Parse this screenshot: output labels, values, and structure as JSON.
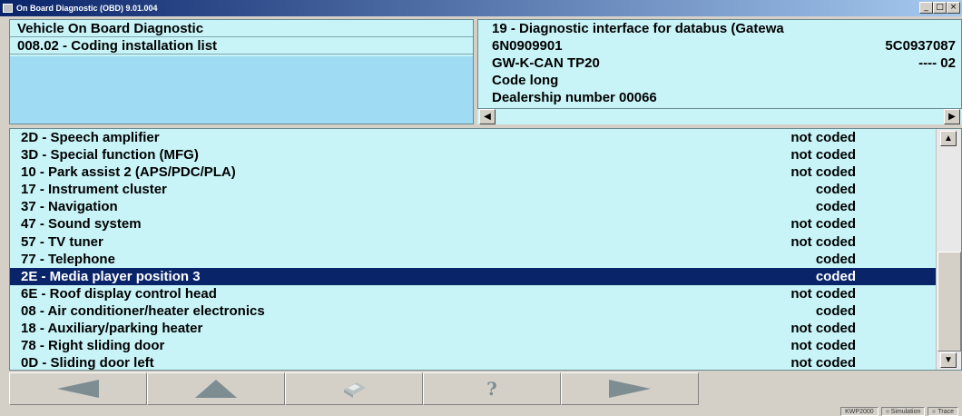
{
  "window": {
    "title": "On Board Diagnostic (OBD) 9.01.004",
    "minimize": "_",
    "maximize": "□",
    "close": "×"
  },
  "left_panel": {
    "line1": "Vehicle On Board Diagnostic",
    "line2": "008.02 - Coding installation list"
  },
  "right_panel": {
    "title": "19 - Diagnostic interface for databus (Gatewa",
    "part_left": "6N0909901",
    "part_right": "5C0937087",
    "component_left": "GW-K-CAN TP20",
    "component_right": "---- 02",
    "coding": "Code long",
    "dealership": "Dealership number 00066"
  },
  "list": {
    "rows": [
      {
        "name": "2D - Speech amplifier",
        "status": "not coded"
      },
      {
        "name": "3D - Special function (MFG)",
        "status": "not coded"
      },
      {
        "name": "10 - Park assist 2 (APS/PDC/PLA)",
        "status": "not coded"
      },
      {
        "name": "17 - Instrument cluster",
        "status": "coded"
      },
      {
        "name": "37 - Navigation",
        "status": "coded"
      },
      {
        "name": "47 - Sound system",
        "status": "not coded"
      },
      {
        "name": "57 - TV tuner",
        "status": "not coded"
      },
      {
        "name": "77 - Telephone",
        "status": "coded"
      },
      {
        "name": "2E - Media player position 3",
        "status": "coded"
      },
      {
        "name": "6E - Roof display control head",
        "status": "not coded"
      },
      {
        "name": "08 - Air conditioner/heater electronics",
        "status": "coded"
      },
      {
        "name": "18 - Auxiliary/parking heater",
        "status": "not coded"
      },
      {
        "name": "78 - Right sliding door",
        "status": "not coded"
      },
      {
        "name": "0D - Sliding door left",
        "status": "not coded"
      }
    ],
    "selected_index": 8
  },
  "toolbar": {
    "buttons": [
      "arrow-left-icon",
      "arrow-up-icon",
      "print-icon",
      "help-icon",
      "arrow-right-icon"
    ]
  },
  "statusbar": {
    "protocol": "KWP2000",
    "simulation": "Simulation",
    "trace": "Trace"
  },
  "colors": {
    "panel_bg": "#c8f4f8",
    "selected_bg": "#0a246a",
    "blank_area": "#9fdcf4"
  }
}
